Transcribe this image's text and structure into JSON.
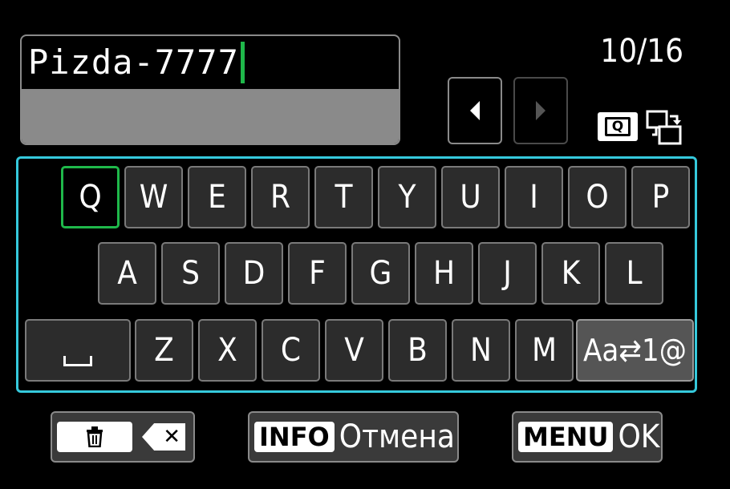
{
  "text_input": {
    "value": "Pizda-7777",
    "char_count": "10/16"
  },
  "nav": {
    "prev_icon": "left-arrow-icon",
    "next_icon": "right-arrow-icon"
  },
  "icons": {
    "quick_control": "Q",
    "swap_area": "swap-area-icon"
  },
  "keyboard": {
    "selected_key": "Q",
    "row1": [
      "Q",
      "W",
      "E",
      "R",
      "T",
      "Y",
      "U",
      "I",
      "O",
      "P"
    ],
    "row2": [
      "A",
      "S",
      "D",
      "F",
      "G",
      "H",
      "J",
      "K",
      "L"
    ],
    "row3": [
      "Z",
      "X",
      "C",
      "V",
      "B",
      "N",
      "M"
    ],
    "space_key": "space-icon",
    "mode_key": "Aa⇄1@"
  },
  "buttons": {
    "delete": {
      "icon": "trash-icon",
      "key_icon": "backspace-icon"
    },
    "cancel": {
      "key_label": "INFO",
      "label": "Отмена"
    },
    "ok": {
      "key_label": "MENU",
      "label": "OK"
    }
  },
  "colors": {
    "accent_frame": "#35c9dc",
    "selection": "#1fb84a",
    "cursor": "#1fb84a"
  }
}
